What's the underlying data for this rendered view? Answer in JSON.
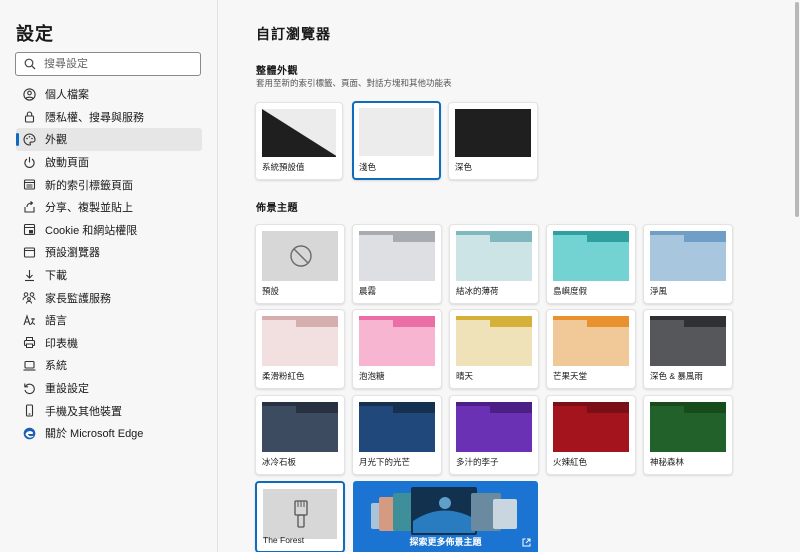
{
  "sidebar": {
    "title": "設定",
    "search_placeholder": "搜尋設定",
    "items": [
      {
        "label": "個人檔案",
        "icon": "profile-icon"
      },
      {
        "label": "隱私權、搜尋與服務",
        "icon": "lock-icon"
      },
      {
        "label": "外觀",
        "icon": "palette-icon",
        "active": true
      },
      {
        "label": "啟動頁面",
        "icon": "power-icon"
      },
      {
        "label": "新的索引標籤頁面",
        "icon": "new-tab-icon"
      },
      {
        "label": "分享、複製並貼上",
        "icon": "share-icon"
      },
      {
        "label": "Cookie 和網站權限",
        "icon": "site-permissions-icon"
      },
      {
        "label": "預設瀏覽器",
        "icon": "browser-icon"
      },
      {
        "label": "下載",
        "icon": "download-icon"
      },
      {
        "label": "家長監護服務",
        "icon": "family-icon"
      },
      {
        "label": "語言",
        "icon": "language-icon"
      },
      {
        "label": "印表機",
        "icon": "printer-icon"
      },
      {
        "label": "系統",
        "icon": "system-icon"
      },
      {
        "label": "重設設定",
        "icon": "reset-icon"
      },
      {
        "label": "手機及其他裝置",
        "icon": "phone-icon"
      },
      {
        "label": "關於 Microsoft Edge",
        "icon": "edge-icon"
      }
    ]
  },
  "main": {
    "title": "自訂瀏覽器",
    "appearance": {
      "title": "整體外觀",
      "subtitle": "套用至新的索引標籤、頁面、對話方塊和其他功能表",
      "options": [
        {
          "label": "系統預設值",
          "selected": false
        },
        {
          "label": "淺色",
          "selected": true
        },
        {
          "label": "深色",
          "selected": false
        }
      ]
    },
    "themes": {
      "title": "佈景主題",
      "items": [
        {
          "label": "預設",
          "type": "none"
        },
        {
          "label": "晨霧",
          "bar": "#a8abb0",
          "body": "#dedfe2",
          "tab": "#dedfe2"
        },
        {
          "label": "結冰的薄荷",
          "bar": "#7fb8bf",
          "body": "#cde4e6",
          "tab": "#cde4e6"
        },
        {
          "label": "島嶼度假",
          "bar": "#2f9f9f",
          "body": "#72d3d2",
          "tab": "#72d3d2"
        },
        {
          "label": "淨風",
          "bar": "#6f9ec6",
          "body": "#a8c7de",
          "tab": "#a8c7de"
        },
        {
          "label": "柔滑粉紅色",
          "bar": "#d6aeae",
          "body": "#f1e0df",
          "tab": "#f1e0df"
        },
        {
          "label": "泡泡糖",
          "bar": "#ea6fa6",
          "body": "#f8b5d1",
          "tab": "#f8b5d1"
        },
        {
          "label": "晴天",
          "bar": "#d6b13a",
          "body": "#efe2b8",
          "tab": "#efe2b8"
        },
        {
          "label": "芒果天堂",
          "bar": "#e8912d",
          "body": "#f1c897",
          "tab": "#f1c897"
        },
        {
          "label": "深色 & 暴風雨",
          "bar": "#2e3034",
          "body": "#55575b",
          "tab": "#55575b"
        },
        {
          "label": "冰冷石板",
          "bar": "#273142",
          "body": "#3d4b61",
          "tab": "#3d4b61"
        },
        {
          "label": "月光下的光芒",
          "bar": "#16304f",
          "body": "#21487a",
          "tab": "#21487a"
        },
        {
          "label": "多汁的李子",
          "bar": "#4c1f86",
          "body": "#6a31b4",
          "tab": "#6a31b4"
        },
        {
          "label": "火辣紅色",
          "bar": "#7a0f16",
          "body": "#a3141d",
          "tab": "#a3141d"
        },
        {
          "label": "神秘森林",
          "bar": "#184b1c",
          "body": "#22622a",
          "tab": "#22622a"
        },
        {
          "label": "The Forest",
          "type": "custom"
        }
      ],
      "explore_label": "探索更多佈景主題"
    }
  },
  "colors": {
    "accent": "#0f6cbd",
    "explore_bg": "#1b74d2"
  }
}
